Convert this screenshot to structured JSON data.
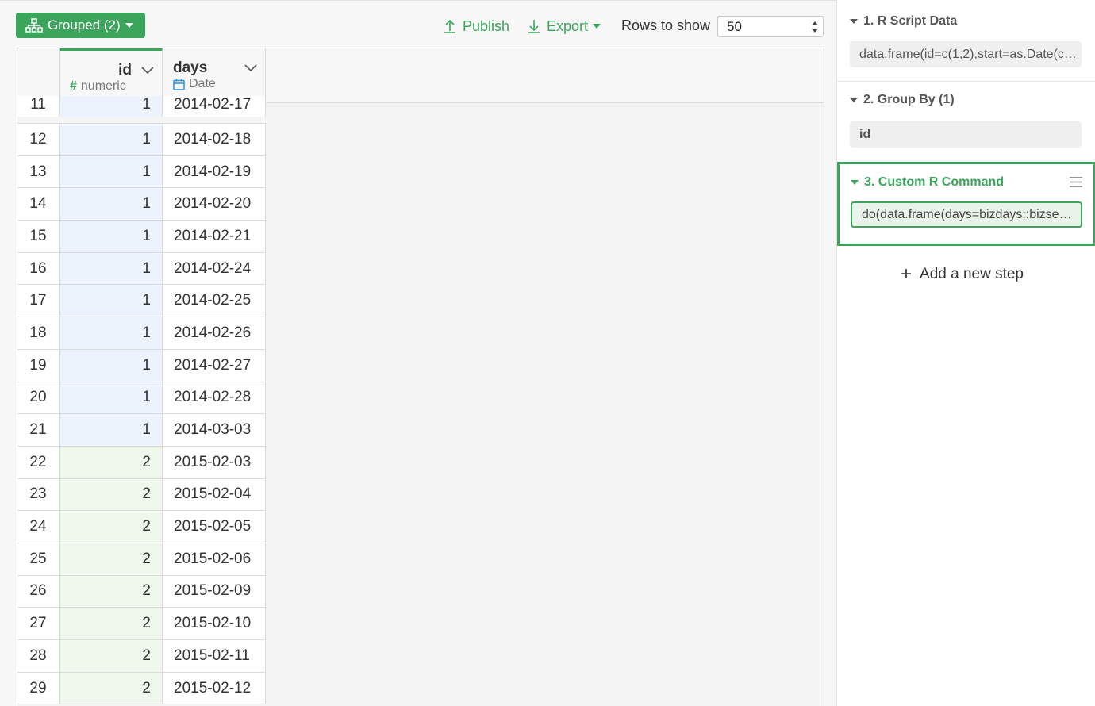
{
  "toolbar": {
    "grouped_label": "Grouped (2)",
    "publish_label": "Publish",
    "export_label": "Export",
    "rows_label": "Rows to show",
    "rows_value": "50"
  },
  "table": {
    "columns": [
      {
        "name": "id",
        "type": "numeric"
      },
      {
        "name": "days",
        "type": "Date"
      }
    ],
    "rows": [
      {
        "n": "11",
        "id": "1",
        "days": "2014-02-17"
      },
      {
        "n": "12",
        "id": "1",
        "days": "2014-02-18"
      },
      {
        "n": "13",
        "id": "1",
        "days": "2014-02-19"
      },
      {
        "n": "14",
        "id": "1",
        "days": "2014-02-20"
      },
      {
        "n": "15",
        "id": "1",
        "days": "2014-02-21"
      },
      {
        "n": "16",
        "id": "1",
        "days": "2014-02-24"
      },
      {
        "n": "17",
        "id": "1",
        "days": "2014-02-25"
      },
      {
        "n": "18",
        "id": "1",
        "days": "2014-02-26"
      },
      {
        "n": "19",
        "id": "1",
        "days": "2014-02-27"
      },
      {
        "n": "20",
        "id": "1",
        "days": "2014-02-28"
      },
      {
        "n": "21",
        "id": "1",
        "days": "2014-03-03"
      },
      {
        "n": "22",
        "id": "2",
        "days": "2015-02-03"
      },
      {
        "n": "23",
        "id": "2",
        "days": "2015-02-04"
      },
      {
        "n": "24",
        "id": "2",
        "days": "2015-02-05"
      },
      {
        "n": "25",
        "id": "2",
        "days": "2015-02-06"
      },
      {
        "n": "26",
        "id": "2",
        "days": "2015-02-09"
      },
      {
        "n": "27",
        "id": "2",
        "days": "2015-02-10"
      },
      {
        "n": "28",
        "id": "2",
        "days": "2015-02-11"
      },
      {
        "n": "29",
        "id": "2",
        "days": "2015-02-12"
      }
    ]
  },
  "steps": [
    {
      "title": "1. R Script Data",
      "content": "data.frame(id=c(1,2),start=as.Date(c…"
    },
    {
      "title": "2. Group By (1)",
      "content": "id"
    },
    {
      "title": "3. Custom R Command",
      "content": "do(data.frame(days=bizdays::bizse…"
    }
  ],
  "add_step_label": "Add a new step",
  "colors": {
    "accent": "#3ba55c",
    "group1_bg": "#edf3fc",
    "group2_bg": "#eff6ec"
  }
}
